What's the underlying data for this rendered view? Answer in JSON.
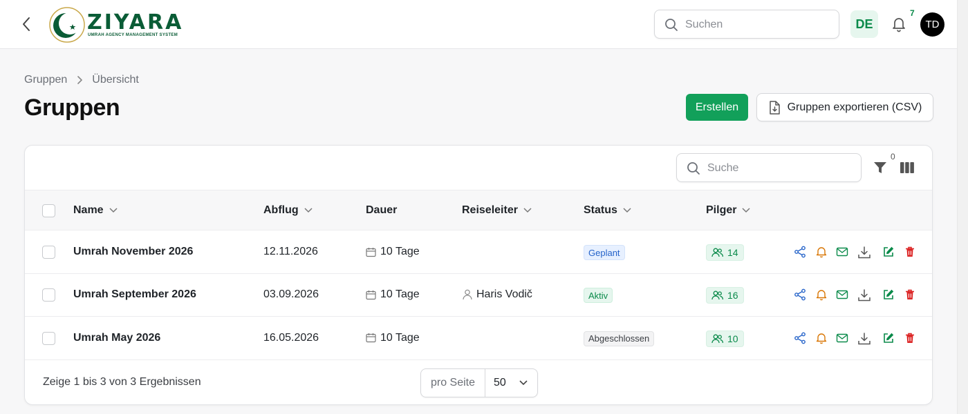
{
  "header": {
    "logo_text": "ZIYARA",
    "logo_subtitle": "UMRAH AGENCY MANAGEMENT SYSTEM",
    "search_placeholder": "Suchen",
    "language": "DE",
    "notification_count": "7",
    "avatar_initials": "TD"
  },
  "breadcrumb": {
    "parent": "Gruppen",
    "current": "Übersicht"
  },
  "page": {
    "title": "Gruppen",
    "create_label": "Erstellen",
    "export_label": "Gruppen exportieren (CSV)"
  },
  "table": {
    "search_placeholder": "Suche",
    "filter_count": "0",
    "columns": [
      "Name",
      "Abflug",
      "Dauer",
      "Reiseleiter",
      "Status",
      "Pilger"
    ],
    "rows": [
      {
        "name": "Umrah November 2026",
        "departure": "12.11.2026",
        "duration": "10 Tage",
        "leader": "",
        "status": "Geplant",
        "pilgrims": "14"
      },
      {
        "name": "Umrah September 2026",
        "departure": "03.09.2026",
        "duration": "10 Tage",
        "leader": "Haris Vodič",
        "status": "Aktiv",
        "pilgrims": "16"
      },
      {
        "name": "Umrah May 2026",
        "departure": "16.05.2026",
        "duration": "10 Tage",
        "leader": "",
        "status": "Abgeschlossen",
        "pilgrims": "10"
      }
    ],
    "footer": {
      "results_text": "Zeige 1 bis 3 von 3 Ergebnissen",
      "per_page_label": "pro Seite",
      "per_page_value": "50"
    }
  },
  "colors": {
    "accent": "#12a05a",
    "brand": "#0a5c36",
    "status_planned": "#2563c9",
    "status_active": "#0a8a4a",
    "action_share": "#2563c9",
    "action_bell": "#d97706",
    "action_mail": "#0a8a4a",
    "action_edit": "#0a8a4a",
    "action_delete": "#dc2626"
  }
}
